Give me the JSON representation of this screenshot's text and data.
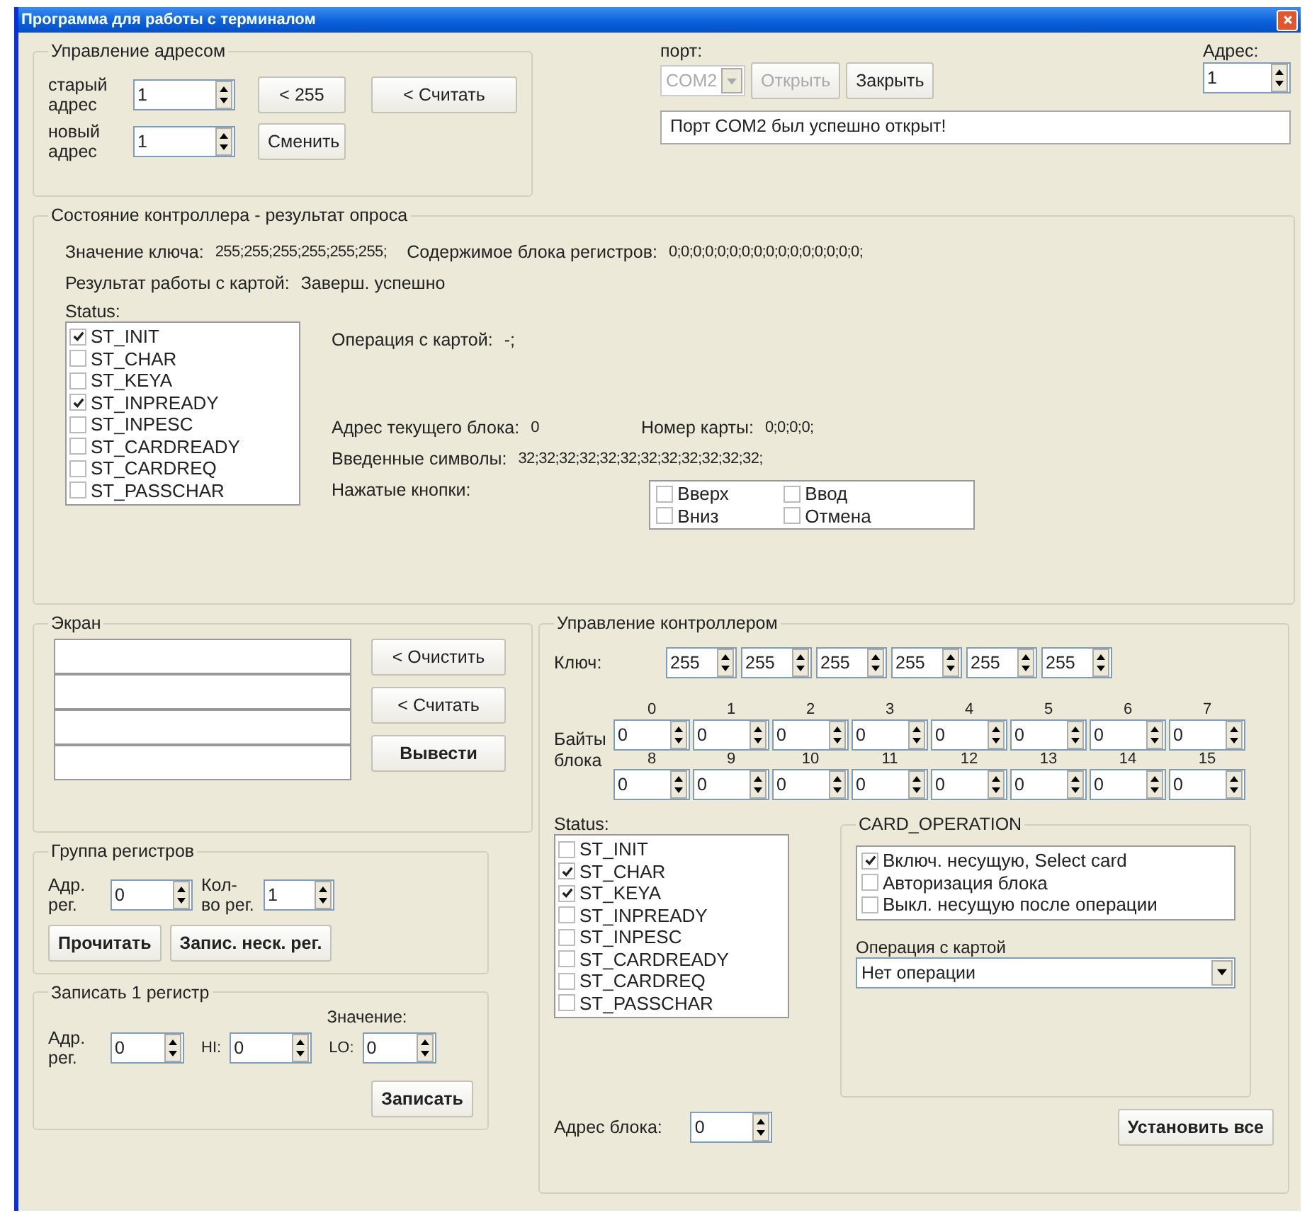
{
  "window": {
    "title": "Программа для работы с терминалом"
  },
  "address_group": {
    "title": "Управление адресом",
    "old_label": "старый адрес",
    "old_value": "1",
    "new_label": "новый адрес",
    "new_value": "1",
    "buttons": [
      "< 255",
      "< Считать",
      "Сменить"
    ]
  },
  "port": {
    "label": "порт:",
    "value": "COM2",
    "combo_disabled": true,
    "open_button": {
      "label": "Открыть",
      "disabled": true
    },
    "close_button": {
      "label": "Закрыть",
      "disabled": false
    },
    "address_label": "Адрес:",
    "address_value": "1",
    "message": "Порт COM2 был успешно открыт!"
  },
  "controller_state": {
    "title": "Состояние контроллера - результат опроса",
    "key_label": "Значение ключа:",
    "key_value": "255;255;255;255;255;255;",
    "registers_label": "Содержимое блока регистров:",
    "registers_value": "0;0;0;0;0;0;0;0;0;0;0;0;0;0;0;0;",
    "result_label": "Результат работы с картой:",
    "result_value": "Заверш. успешно",
    "status_label": "Status:",
    "status": [
      {
        "label": "ST_INIT",
        "checked": true
      },
      {
        "label": "ST_CHAR",
        "checked": false
      },
      {
        "label": "ST_KEYA",
        "checked": false
      },
      {
        "label": "ST_INPREADY",
        "checked": true
      },
      {
        "label": "ST_INPESC",
        "checked": false
      },
      {
        "label": "ST_CARDREADY",
        "checked": false
      },
      {
        "label": "ST_CARDREQ",
        "checked": false
      },
      {
        "label": "ST_PASSCHAR",
        "checked": false
      }
    ],
    "operation_label": "Операция с картой:",
    "operation_value": "-;",
    "block_address_label": "Адрес текущего блока:",
    "block_address_value": "0",
    "card_number_label": "Номер карты:",
    "card_number_value": "0;0;0;0;",
    "symbols_label": "Введенные символы:",
    "symbols_value": "32;32;32;32;32;32;32;32;32;32;32;32;",
    "keys_label": "Нажатые кнопки:",
    "keys": [
      {
        "label": "Вверх",
        "checked": false
      },
      {
        "label": "Ввод",
        "checked": false
      },
      {
        "label": "Вниз",
        "checked": false
      },
      {
        "label": "Отмена",
        "checked": false
      }
    ]
  },
  "screen": {
    "title": "Экран",
    "buttons": [
      "< Очистить",
      "< Считать",
      "Вывести"
    ]
  },
  "register_group": {
    "title": "Группа регистров",
    "addr_label": "Адр. рег.",
    "addr_value": "0",
    "count_label": "Кол-во рег.",
    "count_value": "1",
    "buttons": [
      "Прочитать",
      "Запис. неск. рег."
    ]
  },
  "write_register": {
    "title": "Записать 1 регистр",
    "addr_label": "Адр. рег.",
    "addr_value": "0",
    "value_label": "Значение:",
    "hi_label": "HI:",
    "hi_value": "0",
    "lo_label": "LO:",
    "lo_value": "0",
    "button": "Записать"
  },
  "controller_control": {
    "title": "Управление контроллером",
    "key_label": "Ключ:",
    "key": [
      "255",
      "255",
      "255",
      "255",
      "255",
      "255"
    ],
    "bytes_label": "Байты блока",
    "byte_indices": [
      "0",
      "1",
      "2",
      "3",
      "4",
      "5",
      "6",
      "7",
      "8",
      "9",
      "10",
      "11",
      "12",
      "13",
      "14",
      "15"
    ],
    "bytes": [
      "0",
      "0",
      "0",
      "0",
      "0",
      "0",
      "0",
      "0",
      "0",
      "0",
      "0",
      "0",
      "0",
      "0",
      "0",
      "0"
    ],
    "status_label": "Status:",
    "status": [
      {
        "label": "ST_INIT",
        "checked": false
      },
      {
        "label": "ST_CHAR",
        "checked": true
      },
      {
        "label": "ST_KEYA",
        "checked": true
      },
      {
        "label": "ST_INPREADY",
        "checked": false
      },
      {
        "label": "ST_INPESC",
        "checked": false
      },
      {
        "label": "ST_CARDREADY",
        "checked": false
      },
      {
        "label": "ST_CARDREQ",
        "checked": false
      },
      {
        "label": "ST_PASSCHAR",
        "checked": false
      }
    ],
    "card_operation": {
      "title": "CARD_OPERATION",
      "options": [
        {
          "label": "Включ. несущую, Select card",
          "checked": true
        },
        {
          "label": "Авторизация блока",
          "checked": false
        },
        {
          "label": "Выкл. несущую после операции",
          "checked": false
        }
      ],
      "operation_label": "Операция с картой",
      "operation_value": "Нет операции"
    },
    "block_address_label": "Адрес блока:",
    "block_address_value": "0",
    "set_all_button": "Установить все"
  }
}
